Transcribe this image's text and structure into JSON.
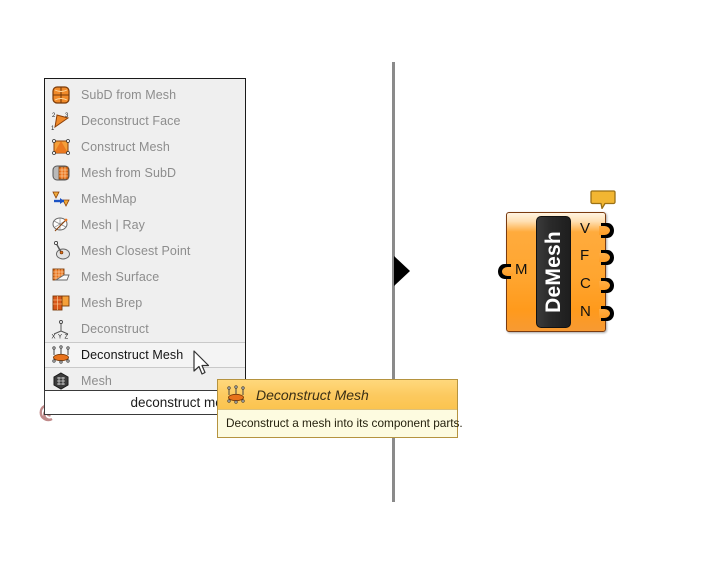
{
  "menu": {
    "name": "component-search-popup",
    "items": [
      {
        "label": "SubD from Mesh",
        "icon": "subd-from-mesh-icon",
        "selected": false
      },
      {
        "label": "Deconstruct Face",
        "icon": "deconstruct-face-icon",
        "selected": false
      },
      {
        "label": "Construct Mesh",
        "icon": "construct-mesh-icon",
        "selected": false
      },
      {
        "label": "Mesh from SubD",
        "icon": "mesh-from-subd-icon",
        "selected": false
      },
      {
        "label": "MeshMap",
        "icon": "meshmap-icon",
        "selected": false
      },
      {
        "label": "Mesh | Ray",
        "icon": "mesh-ray-icon",
        "selected": false
      },
      {
        "label": "Mesh Closest Point",
        "icon": "mesh-closest-point-icon",
        "selected": false
      },
      {
        "label": "Mesh Surface",
        "icon": "mesh-surface-icon",
        "selected": false
      },
      {
        "label": "Mesh Brep",
        "icon": "mesh-brep-icon",
        "selected": false
      },
      {
        "label": "Deconstruct",
        "icon": "deconstruct-xyz-icon",
        "selected": false
      },
      {
        "label": "Deconstruct Mesh",
        "icon": "deconstruct-mesh-icon",
        "selected": true
      },
      {
        "label": "Mesh",
        "icon": "mesh-icon",
        "selected": false
      }
    ]
  },
  "search": {
    "value": "deconstruct mesh",
    "placeholder": "",
    "spiral_icon": "spiral-search-icon"
  },
  "tooltip": {
    "title": "Deconstruct Mesh",
    "description": "Deconstruct a mesh into its component parts.",
    "icon": "deconstruct-mesh-icon",
    "header_color": "#fbc44f",
    "body_color": "#fdfbe0"
  },
  "component": {
    "nickname": "DeMesh",
    "inputs": [
      {
        "label": "M"
      }
    ],
    "outputs": [
      {
        "label": "V"
      },
      {
        "label": "F"
      },
      {
        "label": "C"
      },
      {
        "label": "N"
      }
    ],
    "badge_icon": "balloon-warning-icon",
    "body_color": "#ffa52f",
    "capsule_color": "#262626"
  },
  "canvas": {
    "divider_color": "#8a8a8a",
    "marker_icon": "play-triangle-marker"
  }
}
